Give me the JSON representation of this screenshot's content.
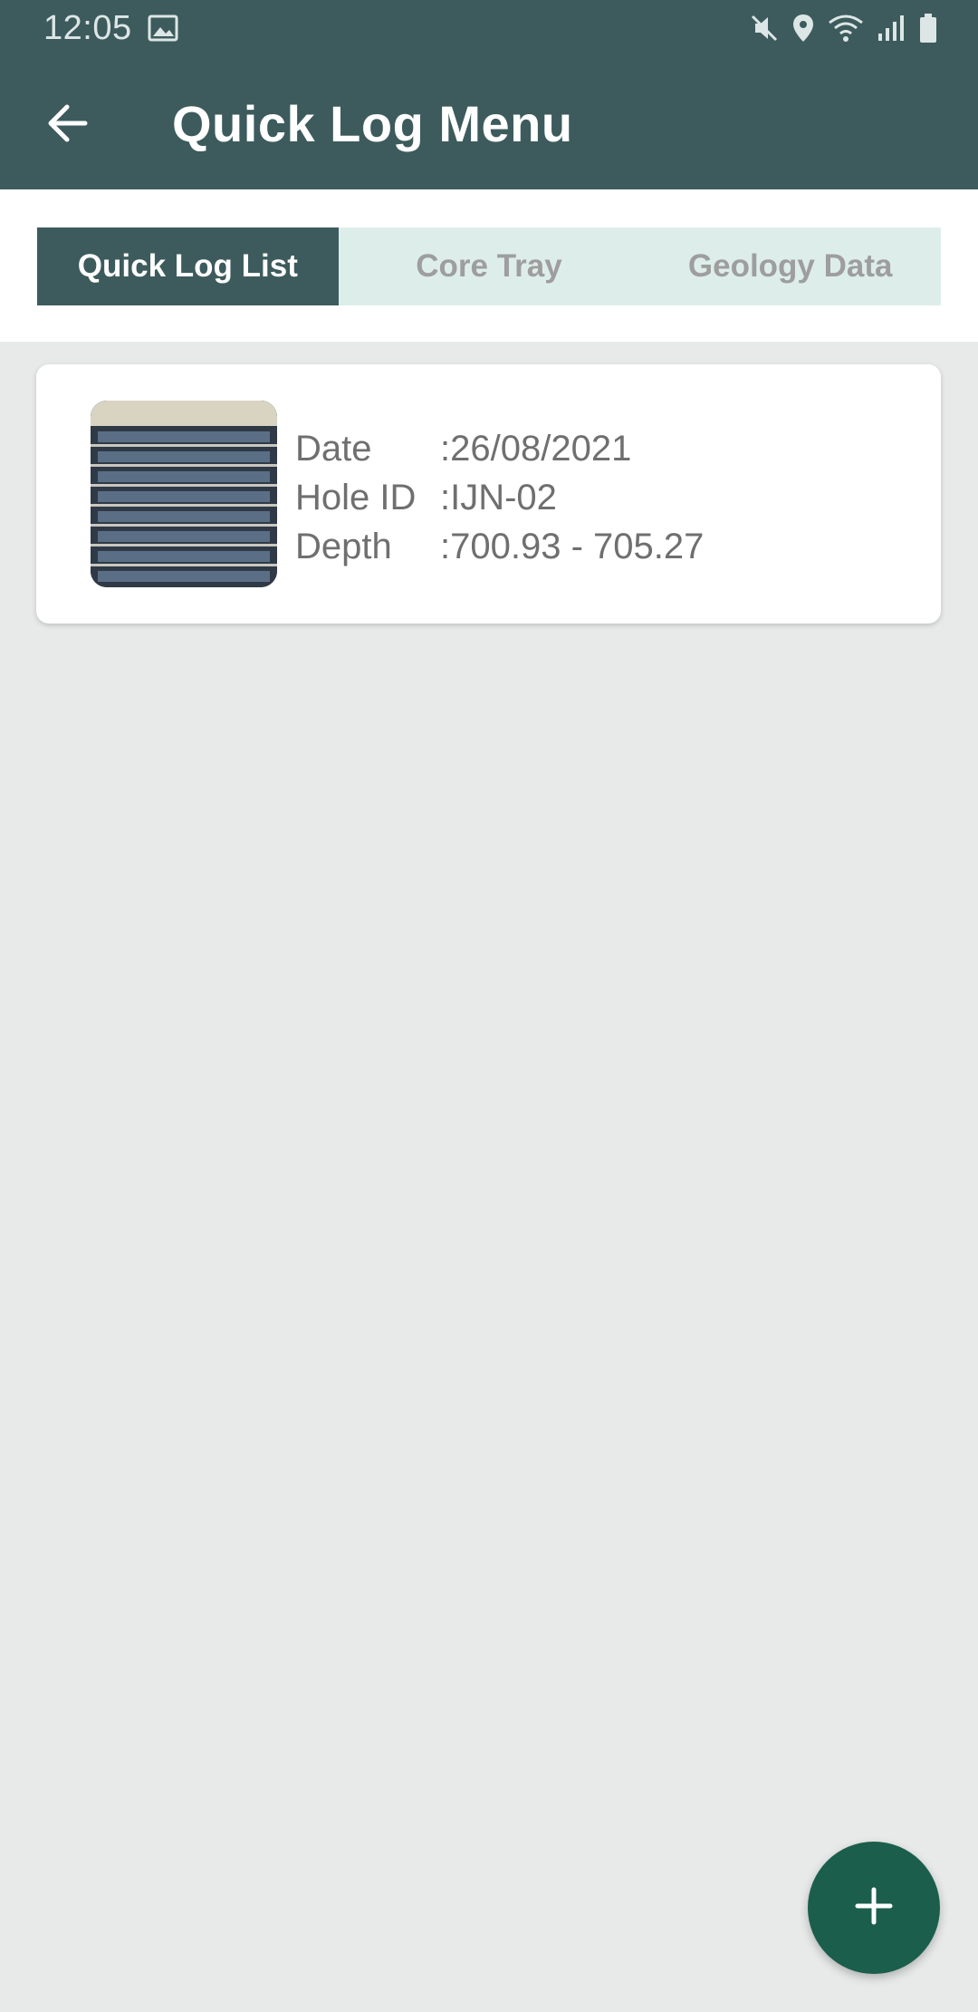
{
  "status_bar": {
    "time": "12:05",
    "icons": [
      "image-icon",
      "mute-icon",
      "location-icon",
      "wifi-icon",
      "signal-icon",
      "battery-icon"
    ]
  },
  "header": {
    "title": "Quick Log Menu",
    "back_icon": "arrow-left-icon",
    "color": "#3D5B5C"
  },
  "tabs": [
    {
      "label": "Quick Log List",
      "active": true
    },
    {
      "label": "Core Tray",
      "active": false
    },
    {
      "label": "Geology Data",
      "active": false
    }
  ],
  "logs": [
    {
      "date_label": "Date",
      "date_value": ":26/08/2021",
      "hole_label": "Hole ID",
      "hole_value": ":IJN-02",
      "depth_label": "Depth",
      "depth_value": ":700.93 - 705.27"
    }
  ],
  "fab": {
    "icon": "plus-icon",
    "color": "#1B5E4B"
  }
}
